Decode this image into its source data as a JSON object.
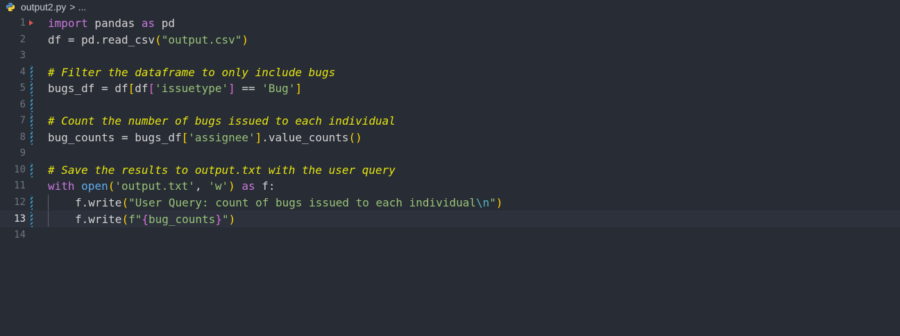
{
  "breadcrumb": {
    "file_name": "output2.py",
    "separator": ">",
    "more": "..."
  },
  "editor": {
    "current_line": 13,
    "line_numbers": [
      "1",
      "2",
      "3",
      "4",
      "5",
      "6",
      "7",
      "8",
      "9",
      "10",
      "11",
      "12",
      "13",
      "14"
    ],
    "tokens": {
      "l1": [
        "import",
        " pandas ",
        "as",
        " pd"
      ],
      "l2": [
        "df = pd.read_csv",
        "(",
        "\"output.csv\"",
        ")"
      ],
      "l4": [
        "# Filter the dataframe to only include bugs"
      ],
      "l5": [
        "bugs_df = df",
        "[",
        "df",
        "[",
        "'issuetype'",
        "]",
        " == ",
        "'Bug'",
        "]"
      ],
      "l7": [
        "# Count the number of bugs issued to each individual"
      ],
      "l8": [
        "bug_counts = bugs_df",
        "[",
        "'assignee'",
        "]",
        ".value_counts",
        "()"
      ],
      "l10": [
        "# Save the results to output.txt with the user query"
      ],
      "l11": [
        "with",
        " ",
        "open",
        "(",
        "'output.txt'",
        ", ",
        "'w'",
        ")",
        " ",
        "as",
        " f:"
      ],
      "l12": [
        "f.write",
        "(",
        "\"User Query: count of bugs issued to each individual",
        "\\n",
        "\"",
        ")"
      ],
      "l13": [
        "f.write",
        "(",
        "f\"",
        "{",
        "bug_counts",
        "}",
        "\"",
        ")"
      ]
    }
  },
  "colors": {
    "background": "#282c34",
    "keyword": "#c678dd",
    "string": "#98c379",
    "comment": "#e5e510",
    "bracket_level1": "#ffd700",
    "bracket_level2": "#da70d6",
    "modified_marker": "#3a9bc7",
    "breakpoint_arrow": "#e05252"
  }
}
